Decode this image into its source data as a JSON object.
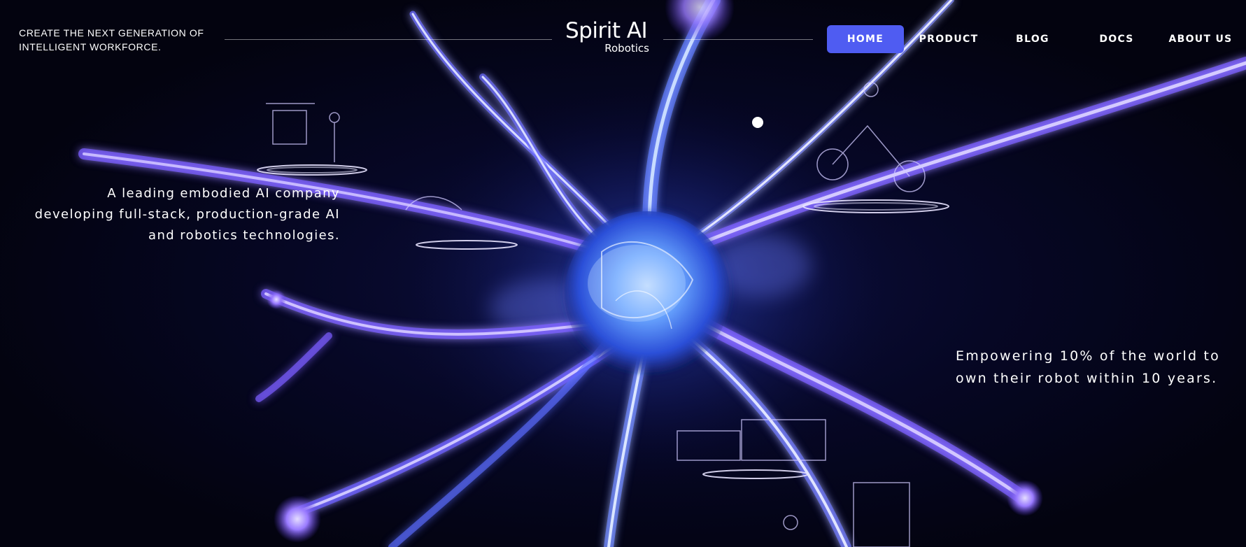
{
  "header": {
    "tagline": "CREATE THE NEXT GENERATION OF INTELLIGENT WORKFORCE.",
    "logo": {
      "main": "Spirit AI",
      "sub": "Robotics"
    }
  },
  "nav": {
    "items": [
      {
        "label": "HOME",
        "active": true
      },
      {
        "label": "PRODUCT",
        "active": false
      },
      {
        "label": "BLOG",
        "active": false
      },
      {
        "label": "DOCS",
        "active": false
      },
      {
        "label": "ABOUT US",
        "active": false
      }
    ]
  },
  "hero": {
    "left_text": "A leading embodied AI company developing full-stack, production-grade AI and robotics technologies.",
    "right_text": "Empowering 10% of the world to own their robot within 10 years.",
    "carousel_current": 1
  },
  "colors": {
    "accent": "#4f5cf2",
    "background": "#03030f",
    "neuron_core": "#7fb3ff",
    "neuron_glow": "#8a63ff"
  },
  "icons": {
    "logo": "spirit-ai-logo",
    "carousel": "carousel-dot"
  }
}
